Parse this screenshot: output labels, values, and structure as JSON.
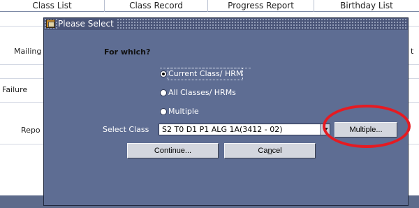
{
  "background": {
    "tabs": [
      "Class List",
      "Class Record",
      "Progress Report",
      "Birthday List"
    ],
    "rows": [
      "Mailing",
      "Failure",
      "Repo"
    ],
    "right_fragment": "t"
  },
  "dialog": {
    "title": "Please Select",
    "question": "For which?",
    "options": [
      {
        "label": "Current Class/ HRM",
        "checked": true
      },
      {
        "label": "All Classes/ HRMs",
        "checked": false
      },
      {
        "label": "Multiple",
        "checked": false
      }
    ],
    "select_label": "Select Class",
    "select_value": "S2 T0 D1 P1 ALG 1A(3412 - 02)",
    "multiple_button": "Multiple...",
    "continue_button": "Continue...",
    "cancel_button": {
      "prefix": "Ca",
      "mnemonic": "n",
      "suffix": "cel"
    }
  },
  "colors": {
    "dialog_bg": "#5e6d93",
    "annotation": "#e51b22"
  }
}
